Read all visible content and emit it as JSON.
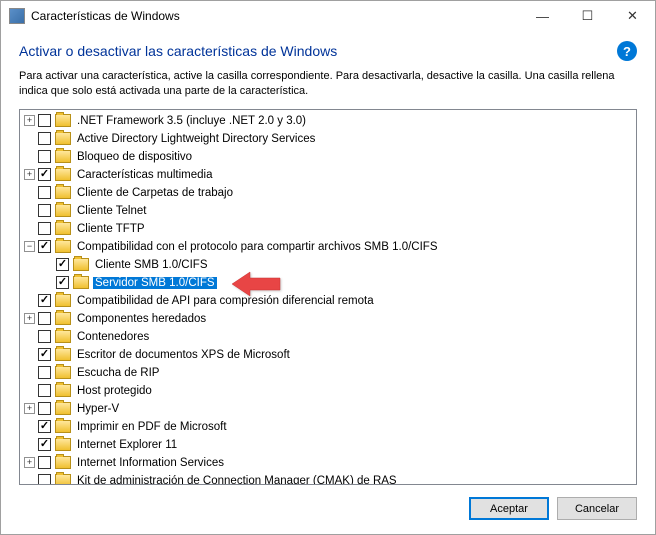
{
  "window": {
    "title": "Características de Windows"
  },
  "header": {
    "heading": "Activar o desactivar las características de Windows"
  },
  "description": "Para activar una característica, active la casilla correspondiente. Para desactivarla, desactive la casilla. Una casilla rellena indica que solo está activada una parte de la característica.",
  "tree": [
    {
      "indent": 0,
      "toggle": "+",
      "check": "",
      "label": ".NET Framework 3.5 (incluye .NET 2.0 y 3.0)"
    },
    {
      "indent": 0,
      "toggle": "",
      "check": "",
      "label": "Active Directory Lightweight Directory Services"
    },
    {
      "indent": 0,
      "toggle": "",
      "check": "",
      "label": "Bloqueo de dispositivo"
    },
    {
      "indent": 0,
      "toggle": "+",
      "check": "✓",
      "label": "Características multimedia"
    },
    {
      "indent": 0,
      "toggle": "",
      "check": "",
      "label": "Cliente de Carpetas de trabajo"
    },
    {
      "indent": 0,
      "toggle": "",
      "check": "",
      "label": "Cliente Telnet"
    },
    {
      "indent": 0,
      "toggle": "",
      "check": "",
      "label": "Cliente TFTP"
    },
    {
      "indent": 0,
      "toggle": "−",
      "check": "✓",
      "label": "Compatibilidad con el protocolo para compartir archivos SMB 1.0/CIFS"
    },
    {
      "indent": 1,
      "toggle": "",
      "check": "✓",
      "label": "Cliente SMB 1.0/CIFS"
    },
    {
      "indent": 1,
      "toggle": "",
      "check": "✓",
      "label": "Servidor SMB 1.0/CIFS",
      "selected": true
    },
    {
      "indent": 0,
      "toggle": "",
      "check": "✓",
      "label": "Compatibilidad de API para compresión diferencial remota"
    },
    {
      "indent": 0,
      "toggle": "+",
      "check": "",
      "label": "Componentes heredados"
    },
    {
      "indent": 0,
      "toggle": "",
      "check": "",
      "label": "Contenedores"
    },
    {
      "indent": 0,
      "toggle": "",
      "check": "✓",
      "label": "Escritor de documentos XPS de Microsoft"
    },
    {
      "indent": 0,
      "toggle": "",
      "check": "",
      "label": "Escucha de RIP"
    },
    {
      "indent": 0,
      "toggle": "",
      "check": "",
      "label": "Host protegido"
    },
    {
      "indent": 0,
      "toggle": "+",
      "check": "",
      "label": "Hyper-V"
    },
    {
      "indent": 0,
      "toggle": "",
      "check": "✓",
      "label": "Imprimir en PDF de Microsoft"
    },
    {
      "indent": 0,
      "toggle": "",
      "check": "✓",
      "label": "Internet Explorer 11"
    },
    {
      "indent": 0,
      "toggle": "+",
      "check": "",
      "label": "Internet Information Services"
    },
    {
      "indent": 0,
      "toggle": "",
      "check": "",
      "label": "Kit de administración de Connection Manager (CMAK) de RAS"
    }
  ],
  "buttons": {
    "ok": "Aceptar",
    "cancel": "Cancelar"
  }
}
